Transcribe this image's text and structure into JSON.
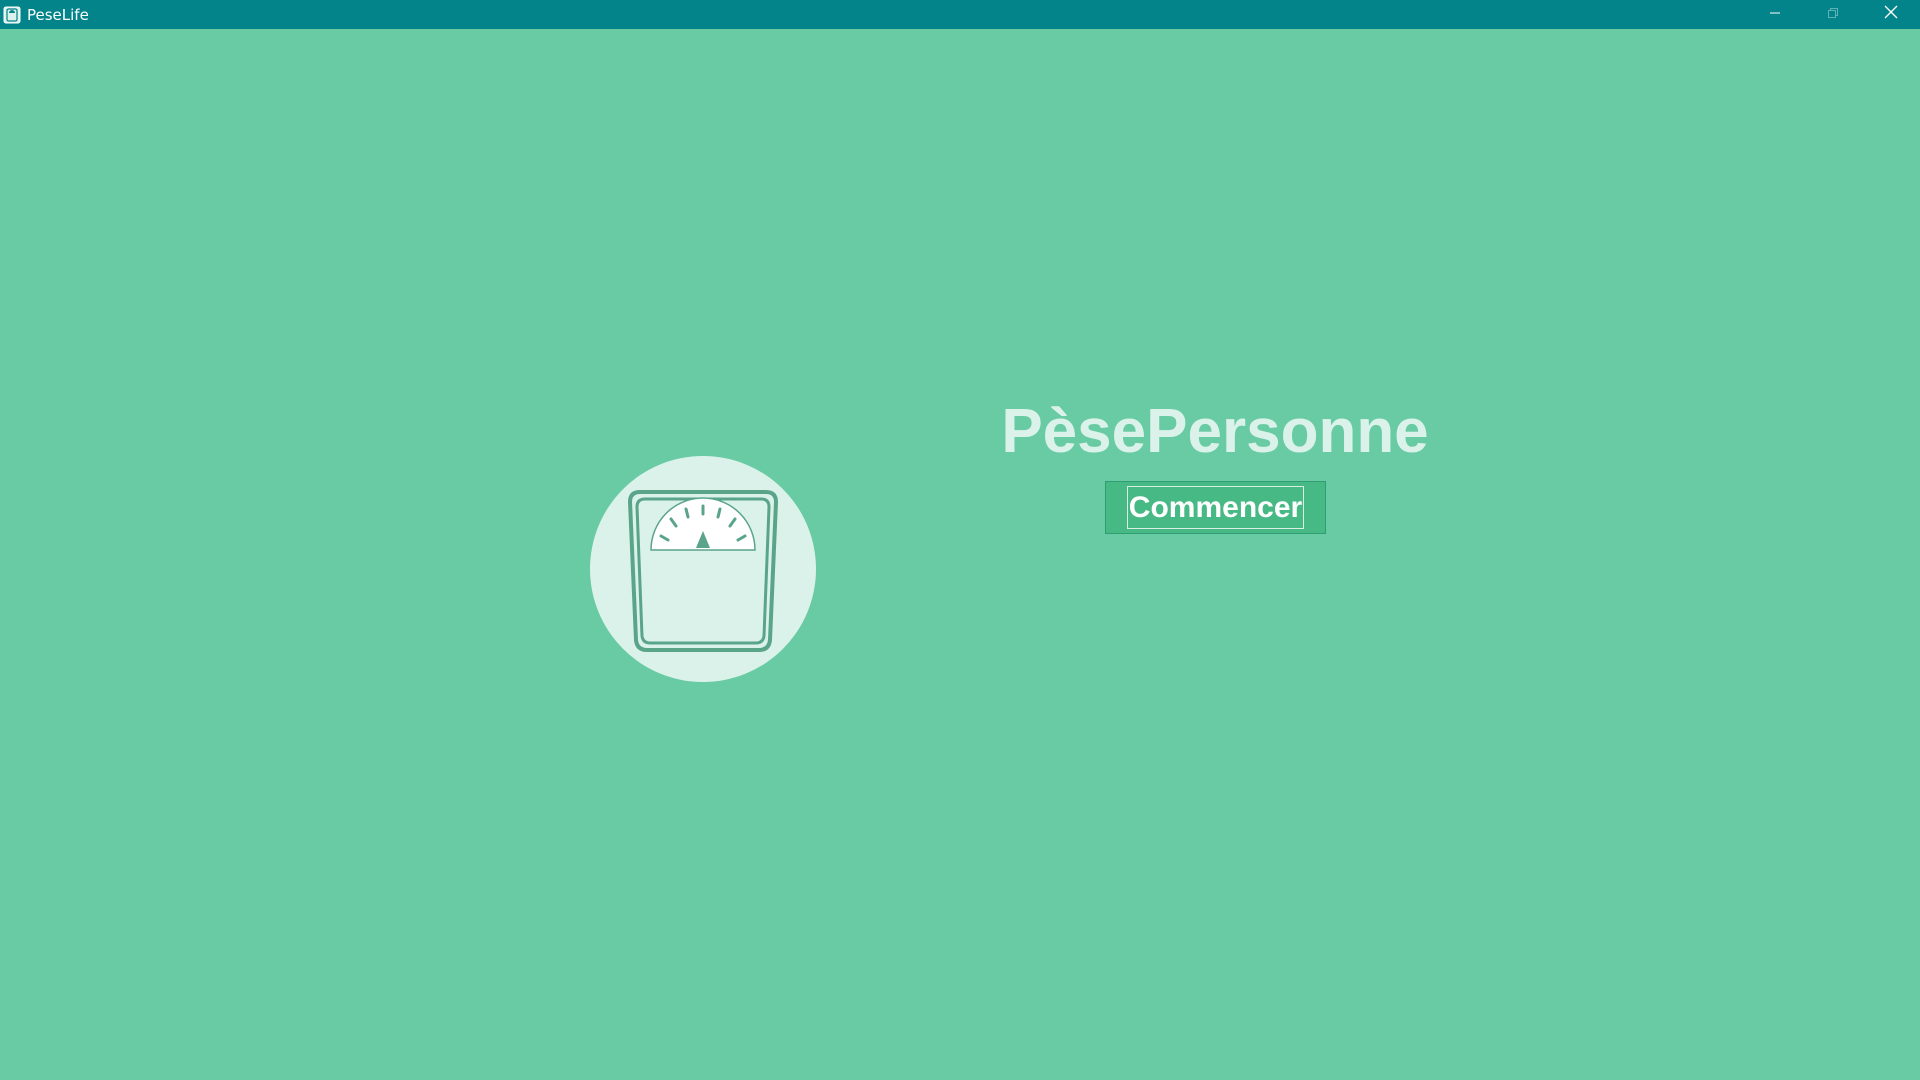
{
  "window": {
    "title": "PeseLife",
    "icon": "scale-app-icon",
    "controls": {
      "minimize": "minimize-icon",
      "maximize": "maximize-icon",
      "close": "close-icon"
    }
  },
  "main": {
    "title": "PèsePersonne",
    "start_button_label": "Commencer",
    "illustration": "bathroom-scale-icon"
  },
  "colors": {
    "titlebar": "#03838a",
    "background": "#68cba3",
    "circle": "#dbf2ea",
    "button": "#47b985",
    "title_text": "#dbf2ea"
  }
}
